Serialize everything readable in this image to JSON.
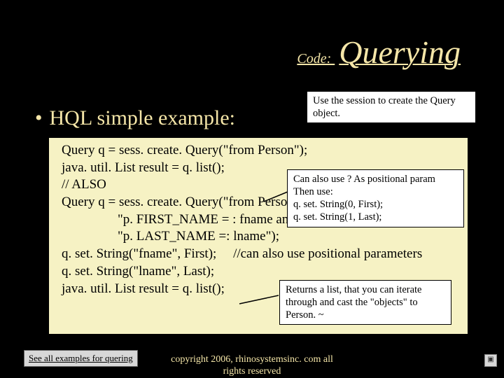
{
  "title": {
    "small": "Code: ",
    "big": "Querying"
  },
  "bullet": "HQL simple example:",
  "code": {
    "l1": "Query q = sess. create. Query(\"from Person\");",
    "l2": "java. util. List result = q. list();",
    "l3": "// ALSO",
    "l4": "Query q = sess. create. Query(\"from Person p where \" +",
    "l5": "\"p. FIRST_NAME = : fname and \" +",
    "l6": "\"p. LAST_NAME =: lname\");",
    "l7": "q. set. String(\"fname\", First);     //can also use positional parameters",
    "l8": "q. set. String(\"lname\", Last);",
    "l9": "java. util. List result = q. list();"
  },
  "callouts": {
    "c1": "Use the session to create the Query object.",
    "c2a": "Can also use ? As positional param",
    "c2b": "Then use:",
    "c2c": "q. set. String(0, First);",
    "c2d": "q. set. String(1, Last);",
    "c3": "Returns a list, that you can iterate through and cast the \"objects\" to Person. ~"
  },
  "footer_link": "See all examples for quering",
  "copyright": "copyright 2006, rhinosystemsinc. com all rights reserved",
  "badge": "▣"
}
